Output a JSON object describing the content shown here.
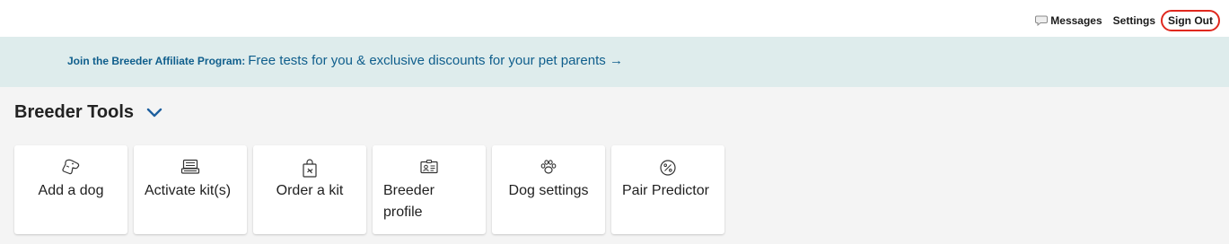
{
  "topnav": {
    "messages_label": "Messages",
    "settings_label": "Settings",
    "signout_label": "Sign Out",
    "highlight_color": "#e0281e"
  },
  "banner": {
    "prefix": "Join the Breeder Affiliate Program:",
    "text": "Free tests for you & exclusive discounts for your pet parents →",
    "background": "#deecec",
    "link_color": "#0f5e8c"
  },
  "section": {
    "title": "Breeder Tools",
    "toggle_icon": "chevron-down-icon"
  },
  "tools": [
    {
      "label": "Add a dog",
      "icon": "dog-tag-icon"
    },
    {
      "label": "Activate kit(s)",
      "icon": "kit-box-icon"
    },
    {
      "label": "Order a kit",
      "icon": "shopping-bag-icon"
    },
    {
      "label": "Breeder profile",
      "icon": "id-card-icon"
    },
    {
      "label": "Dog settings",
      "icon": "paw-icon"
    },
    {
      "label": "Pair Predictor",
      "icon": "percent-circle-icon"
    }
  ]
}
